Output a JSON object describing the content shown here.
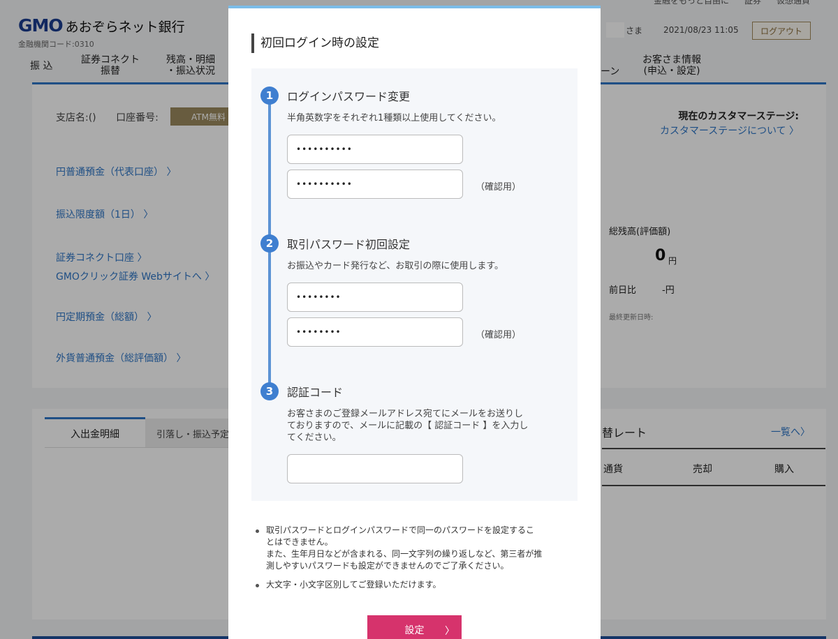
{
  "header": {
    "top_links": [
      "金融をもっと自由に",
      "証券",
      "仮想通貨"
    ],
    "logo_brand": "GMO",
    "logo_name": "あおぞらネット銀行",
    "bank_code": "金融機関コード:0310",
    "user_suffix": "さま",
    "datetime": "2021/08/23 11:05",
    "logout_label": "ログアウト"
  },
  "nav": {
    "items": [
      "振 込",
      "証券コネクト\n振替",
      "残高・明細\n・振込状況",
      "ーン",
      "お客さま情報\n(申込・設定)"
    ]
  },
  "account_panel": {
    "branch_label": "支店名:()",
    "account_label": "口座番号:",
    "atm_label": "ATM無料",
    "stage_label": "現在のカスタマーステージ:",
    "stage_link": "カスタマーステージについて",
    "links": [
      "円普通預金（代表口座）",
      "振込限度額（1日）",
      "証券コネクト口座",
      "GMOクリック証券 Webサイトへ",
      "円定期預金（総額）",
      "外貨普通預金（総評価額）"
    ],
    "total_label": "総残高(評価額)",
    "total_value": "0",
    "total_unit": "円",
    "prev_label": "前日比",
    "prev_value": "-円",
    "updated_label": "最終更新日時:"
  },
  "history_panel": {
    "tab_active": "入出金明細",
    "tab_other": "引落し・振込予定",
    "rate_title": "替レート",
    "rate_link": "一覧へ",
    "rate_columns": [
      "通貨",
      "売却",
      "購入"
    ]
  },
  "modal": {
    "title": "初回ログイン時の設定",
    "steps": [
      {
        "num": "1",
        "title": "ログインパスワード変更",
        "desc": "半角英数字をそれぞれ1種類以上使用してください。",
        "password_value": "••••••••••",
        "confirm_value": "••••••••••",
        "confirm_label": "（確認用）"
      },
      {
        "num": "2",
        "title": "取引パスワード初回設定",
        "desc": "お振込やカード発行など、お取引の際に使用します。",
        "password_value": "••••••••",
        "confirm_value": "••••••••",
        "confirm_label": "（確認用）"
      },
      {
        "num": "3",
        "title": "認証コード",
        "desc_lines": [
          "お客さまのご登録メールアドレス宛てにメールをお送りし",
          "ておりますので、メールに記載の【 認証コード 】を入力し",
          "てください。"
        ],
        "code_value": ""
      }
    ],
    "notes": [
      {
        "lines": [
          "取引パスワードとログインパスワードで同一のパスワードを設定するこ",
          "とはできません。",
          "また、生年月日などが含まれる、同一文字列の繰り返しなど、第三者が推",
          "測しやすいパスワードも設定ができませんのでご了承ください。"
        ]
      },
      {
        "lines": [
          "大文字・小文字区別してご登録いただけます。"
        ]
      }
    ],
    "submit_label": "設定"
  },
  "colors": {
    "accent_blue": "#2f76c6",
    "step_blue": "#3f7fd0",
    "submit_pink": "#d6336c",
    "logo_blue": "#1a3d8f"
  }
}
